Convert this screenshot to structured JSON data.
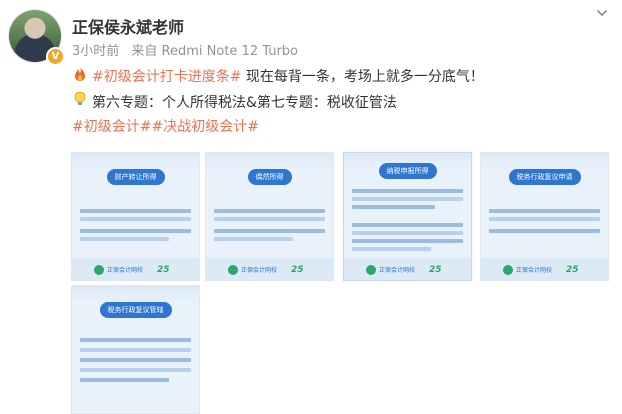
{
  "post": {
    "username": "正保侯永斌老师",
    "time": "3小时前",
    "source": "来自 Redmi Note 12 Turbo",
    "line1_icon": "fire-icon",
    "line1_tag": "#初级会计打卡进度条#",
    "line1_text": " 现在每背一条，考场上就多一分底气！",
    "line2_icon": "lightbulb-icon",
    "line2_text": "第六专题：个人所得税法&第七专题：税收征管法",
    "line3_tags": "#初级会计##决战初级会计#"
  },
  "images": [
    {
      "title": "财产转让所得",
      "brand": "正保会计网校",
      "num": "25"
    },
    {
      "title": "偶然所得",
      "brand": "正保会计网校",
      "num": "25"
    },
    {
      "title": "纳税申报所得",
      "brand": "正保会计网校",
      "num": "25"
    },
    {
      "title": "税务行政复议申请",
      "brand": "正保会计网校",
      "num": "25"
    },
    {
      "title": "税务行政复议管辖"
    }
  ],
  "colors": {
    "tag": "#eb7350",
    "meta": "#939393",
    "accent": "#2f76d0",
    "badge": "#f5a623"
  }
}
